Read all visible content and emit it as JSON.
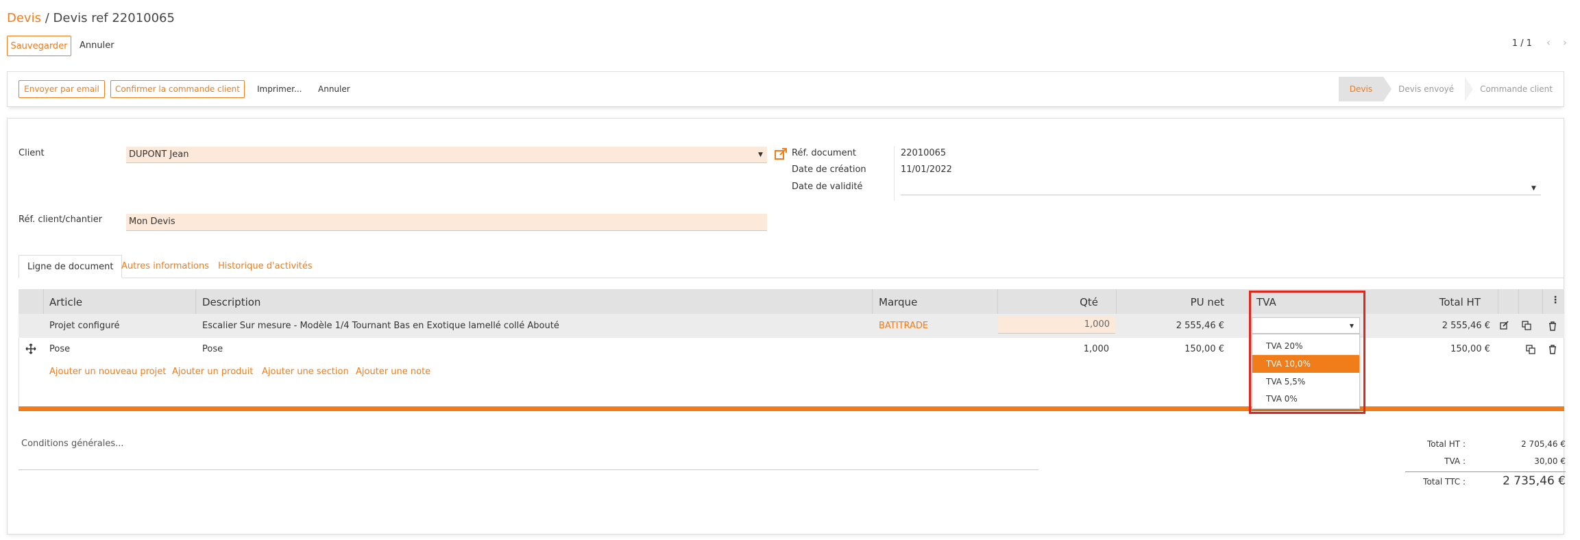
{
  "breadcrumb": {
    "root": "Devis",
    "separator": "/",
    "current": "Devis ref 22010065"
  },
  "actions": {
    "save": "Sauvegarder",
    "cancel": "Annuler"
  },
  "pager": {
    "value": "1 / 1"
  },
  "statusbar": {
    "email": "Envoyer par email",
    "confirm": "Confirmer la commande client",
    "print": "Imprimer...",
    "cancel": "Annuler",
    "stages": [
      "Devis",
      "Devis envoyé",
      "Commande client"
    ],
    "active_stage": "Devis"
  },
  "form": {
    "client_label": "Client",
    "client_value": "DUPONT Jean",
    "ref_client_label": "Réf. client/chantier",
    "ref_client_value": "Mon Devis",
    "ref_document_label": "Réf. document",
    "ref_document_value": "22010065",
    "date_creation_label": "Date de création",
    "date_creation_value": "11/01/2022",
    "date_validite_label": "Date de validité",
    "date_validite_value": ""
  },
  "tabs": [
    "Ligne de document",
    "Autres informations",
    "Historique d'activités"
  ],
  "table": {
    "headers": {
      "article": "Article",
      "description": "Description",
      "marque": "Marque",
      "qte": "Qté",
      "pu_net": "PU net",
      "tva": "TVA",
      "total_ht": "Total HT"
    },
    "rows": [
      {
        "article": "Projet configuré",
        "description": "Escalier Sur mesure - Modèle 1/4 Tournant Bas en Exotique lamellé collé Abouté",
        "marque": "BATITRADE",
        "qte": "1,000",
        "pu_net": "2 555,46 €",
        "tva": "",
        "total_ht": "2 555,46 €"
      },
      {
        "article": "Pose",
        "description": "Pose",
        "marque": "",
        "qte": "1,000",
        "pu_net": "150,00 €",
        "tva": "",
        "total_ht": "150,00 €"
      }
    ],
    "add_links": [
      "Ajouter un nouveau projet",
      "Ajouter un produit",
      "Ajouter une section",
      "Ajouter une note"
    ]
  },
  "tva_dropdown": {
    "options": [
      "TVA 20%",
      "TVA 10,0%",
      "TVA 5,5%",
      "TVA 0%"
    ],
    "highlighted": "TVA 10,0%"
  },
  "conditions_placeholder": "Conditions générales...",
  "totals": {
    "ht_label": "Total HT :",
    "ht_value": "2 705,46 €",
    "tva_label": "TVA :",
    "tva_value": "30,00 €",
    "ttc_label": "Total TTC :",
    "ttc_value": "2 735,46 €"
  },
  "colors": {
    "accent": "#f07c1a",
    "field_bg": "#fde9da",
    "highlight_box": "#e0251b"
  }
}
